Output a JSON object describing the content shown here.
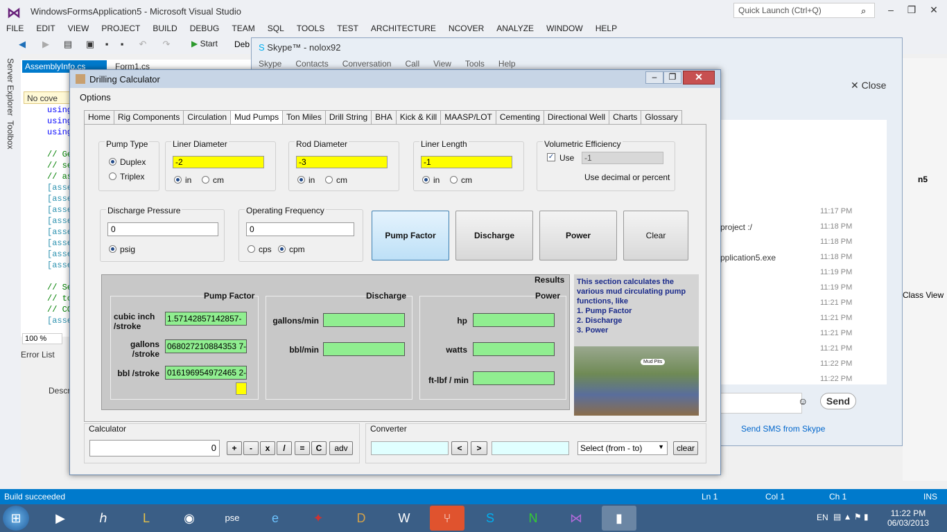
{
  "vs": {
    "title": "WindowsFormsApplication5 - Microsoft Visual Studio",
    "quick_launch_placeholder": "Quick Launch (Ctrl+Q)",
    "menu": [
      "FILE",
      "EDIT",
      "VIEW",
      "PROJECT",
      "BUILD",
      "DEBUG",
      "TEAM",
      "SQL",
      "TOOLS",
      "TEST",
      "ARCHITECTURE",
      "NCOVER",
      "ANALYZE",
      "WINDOW",
      "HELP"
    ],
    "start_label": "Start",
    "debug_dropdown": "Deb",
    "side_tabs": [
      "Server Explorer",
      "Toolbox"
    ],
    "doc_tabs": [
      "AssemblyInfo.cs",
      "Form1.cs"
    ],
    "no_coverage": "No cove",
    "code_lines": [
      "using",
      "using",
      "using",
      "",
      "// Ge",
      "// se",
      "// as",
      "[asse",
      "[asse",
      "[asse",
      "[asse",
      "[asse",
      "[asse",
      "[asse",
      "[asse",
      "",
      "// Se",
      "// to",
      "// CO",
      "[asse"
    ],
    "zoom": "100 %",
    "error_list": "Error List",
    "descr": "Descr",
    "status": {
      "message": "Build succeeded",
      "ln": "Ln 1",
      "col": "Col 1",
      "ch": "Ch 1",
      "mode": "INS"
    },
    "right_panel": {
      "item": "n5",
      "class_view": "Class View"
    }
  },
  "skype": {
    "title": "Skype™ - nolox92",
    "menu": [
      "Skype",
      "Contacts",
      "Conversation",
      "Call",
      "View",
      "Tools",
      "Help"
    ],
    "close_label": "Close",
    "times": [
      "11:17 PM",
      "11:18 PM",
      "11:18 PM",
      "11:18 PM",
      "11:19 PM",
      "11:19 PM",
      "11:21 PM",
      "11:21 PM",
      "11:21 PM",
      "11:21 PM",
      "11:22 PM",
      "11:22 PM"
    ],
    "messages": {
      "m1": "project :/",
      "m2": "pplication5.exe"
    },
    "send_label": "Send",
    "sms_link": "Send SMS from Skype"
  },
  "calc": {
    "title": "Drilling Calculator",
    "options_menu": "Options",
    "tabs": [
      "Home",
      "Rig Components",
      "Circulation",
      "Mud Pumps",
      "Ton Miles",
      "Drill String",
      "BHA",
      "Kick & Kill",
      "MAASP/LOT",
      "Cementing",
      "Directional Well",
      "Charts",
      "Glossary"
    ],
    "active_tab": "Mud Pumps",
    "pump_type": {
      "label": "Pump Type",
      "options": [
        "Duplex",
        "Triplex"
      ],
      "selected": "Duplex"
    },
    "liner_diameter": {
      "label": "Liner Diameter",
      "value": "-2",
      "units": [
        "in",
        "cm"
      ],
      "selected": "in"
    },
    "rod_diameter": {
      "label": "Rod Diameter",
      "value": "-3",
      "units": [
        "in",
        "cm"
      ],
      "selected": "in"
    },
    "liner_length": {
      "label": "Liner Length",
      "value": "-1",
      "units": [
        "in",
        "cm"
      ],
      "selected": "in"
    },
    "vol_eff": {
      "label": "Volumetric Efficiency",
      "use_label": "Use",
      "checked": true,
      "value": "-1",
      "hint": "Use decimal or percent"
    },
    "discharge_pressure": {
      "label": "Discharge Pressure",
      "value": "0",
      "unit": "psig"
    },
    "operating_frequency": {
      "label": "Operating Frequency",
      "value": "0",
      "units": [
        "cps",
        "cpm"
      ],
      "selected": "cpm"
    },
    "buttons": {
      "pump_factor": "Pump Factor",
      "discharge": "Discharge",
      "power": "Power",
      "clear": "Clear"
    },
    "results": {
      "title": "Results",
      "pump_factor": {
        "header": "Pump Factor",
        "rows": [
          {
            "label": "cubic inch /stroke",
            "value": "1.57142857142857-"
          },
          {
            "label": "gallons /stroke",
            "value": "068027210884353 7-"
          },
          {
            "label": "bbl /stroke",
            "value": "016196954972465 2-"
          }
        ]
      },
      "discharge": {
        "header": "Discharge",
        "rows": [
          {
            "label": "gallons/min",
            "value": ""
          },
          {
            "label": "bbl/min",
            "value": ""
          }
        ]
      },
      "power": {
        "header": "Power",
        "rows": [
          {
            "label": "hp",
            "value": ""
          },
          {
            "label": "watts",
            "value": ""
          },
          {
            "label": "ft-lbf / min",
            "value": ""
          }
        ]
      }
    },
    "info": {
      "text": "This section calculates the various mud circulating pump functions, like",
      "items": [
        "1. Pump Factor",
        "2. Discharge",
        "3. Power"
      ],
      "photo_label": "Mud Pits"
    },
    "calculator": {
      "label": "Calculator",
      "display": "0",
      "ops": [
        "+",
        "-",
        "x",
        "/",
        "=",
        "C",
        "adv"
      ]
    },
    "converter": {
      "label": "Converter",
      "prev": "<",
      "next": ">",
      "select": "Select (from - to)",
      "clear": "clear"
    }
  },
  "taskbar": {
    "lang": "EN",
    "time": "11:22 PM",
    "date": "06/03/2013"
  }
}
